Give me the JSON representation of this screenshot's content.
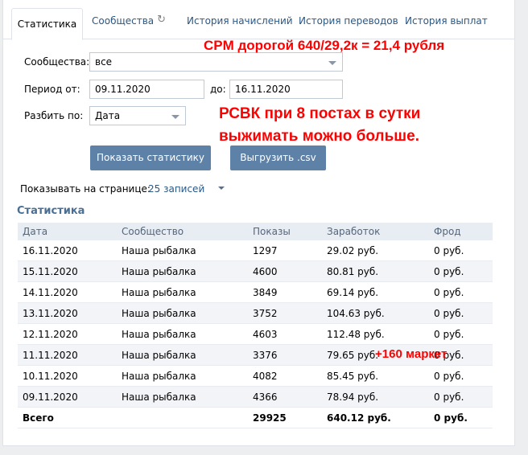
{
  "tabs": [
    {
      "label": "Статистика",
      "active": true
    },
    {
      "label": "Сообщества",
      "icon": "refresh-icon"
    },
    {
      "label": "История начислений"
    },
    {
      "label": "История переводов"
    },
    {
      "label": "История выплат"
    }
  ],
  "form": {
    "communities_label": "Сообщества:",
    "communities_value": "все",
    "period_from_label": "Период от:",
    "period_from_value": "09.11.2020",
    "period_to_label": "до:",
    "period_to_value": "16.11.2020",
    "split_label": "Разбить по:",
    "split_value": "Дата"
  },
  "buttons": {
    "show_stats": "Показать статистику",
    "export_csv": "Выгрузить .csv"
  },
  "per_page": {
    "label": "Показывать на странице:",
    "value": "25 записей"
  },
  "section_title": "Статистика",
  "table": {
    "headers": [
      "Дата",
      "Сообщество",
      "Показы",
      "Заработок",
      "Фрод"
    ],
    "rows": [
      [
        "16.11.2020",
        "Наша рыбалка",
        "1297",
        "29.02 руб.",
        "0 руб."
      ],
      [
        "15.11.2020",
        "Наша рыбалка",
        "4600",
        "80.81 руб.",
        "0 руб."
      ],
      [
        "14.11.2020",
        "Наша рыбалка",
        "3849",
        "69.14 руб.",
        "0 руб."
      ],
      [
        "13.11.2020",
        "Наша рыбалка",
        "3752",
        "104.63 руб.",
        "0 руб."
      ],
      [
        "12.11.2020",
        "Наша рыбалка",
        "4603",
        "112.48 руб.",
        "0 руб."
      ],
      [
        "11.11.2020",
        "Наша рыбалка",
        "3376",
        "79.65 руб.",
        "0 руб."
      ],
      [
        "10.11.2020",
        "Наша рыбалка",
        "4082",
        "85.45 руб.",
        "0 руб."
      ],
      [
        "09.11.2020",
        "Наша рыбалка",
        "4366",
        "78.94 руб.",
        "0 руб."
      ]
    ],
    "total": [
      "Всего",
      "",
      "29925",
      "640.12 руб.",
      "0 руб."
    ]
  },
  "annotations": {
    "cpm": "CPM дорогой 640/29,2к = 21,4 рубля",
    "rsvk_line1": "РСВК при 8 постах в сутки",
    "rsvk_line2": "выжимать можно больше.",
    "market": "+160 маркет"
  },
  "colors": {
    "accent": "#5e81a8",
    "link": "#2a5885",
    "annotation": "#ff0000"
  }
}
